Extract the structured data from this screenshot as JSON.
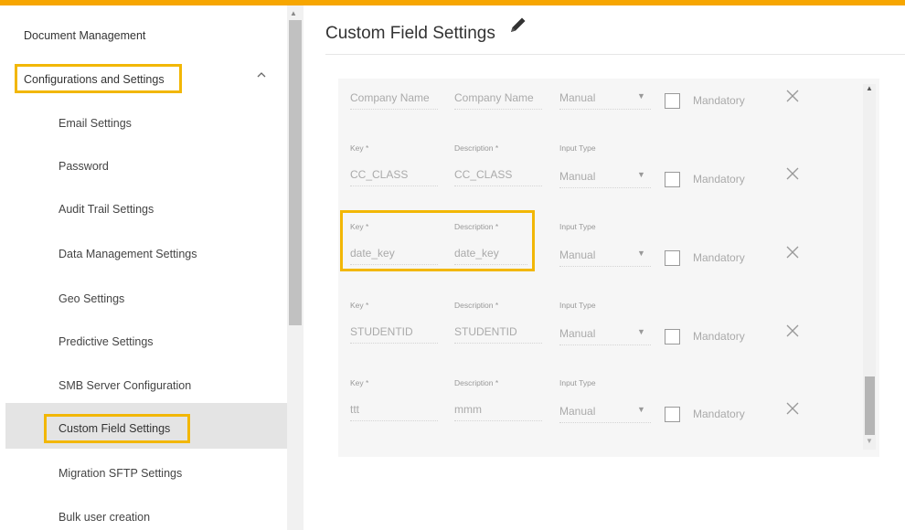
{
  "sidebar": {
    "items": [
      {
        "label": "Document Management"
      },
      {
        "label": "Configurations and Settings"
      },
      {
        "label": "Email Settings"
      },
      {
        "label": "Password"
      },
      {
        "label": "Audit Trail Settings"
      },
      {
        "label": "Data Management Settings"
      },
      {
        "label": "Geo Settings"
      },
      {
        "label": "Predictive Settings"
      },
      {
        "label": "SMB Server Configuration"
      },
      {
        "label": "Custom Field Settings"
      },
      {
        "label": "Migration SFTP Settings"
      },
      {
        "label": "Bulk user creation"
      }
    ],
    "expanded_icon": "chevron-up-icon",
    "active_item": "Custom Field Settings"
  },
  "main": {
    "title": "Custom Field Settings",
    "edit_icon": "pencil-icon"
  },
  "fields": {
    "labels": {
      "key": "Key *",
      "description": "Description *",
      "input_type": "Input Type"
    },
    "mandatory_label": "Mandatory",
    "rows": [
      {
        "key": "Company Name",
        "description": "Company Name",
        "input_type": "Manual"
      },
      {
        "key": "CC_CLASS",
        "description": "CC_CLASS",
        "input_type": "Manual"
      },
      {
        "key": "date_key",
        "description": "date_key",
        "input_type": "Manual"
      },
      {
        "key": "STUDENTID",
        "description": "STUDENTID",
        "input_type": "Manual"
      },
      {
        "key": "ttt",
        "description": "mmm",
        "input_type": "Manual"
      }
    ]
  },
  "colors": {
    "accent": "#f7a600",
    "highlight": "#f2b705",
    "active_bg": "#e4e4e4",
    "panel_bg": "#f6f6f6"
  }
}
